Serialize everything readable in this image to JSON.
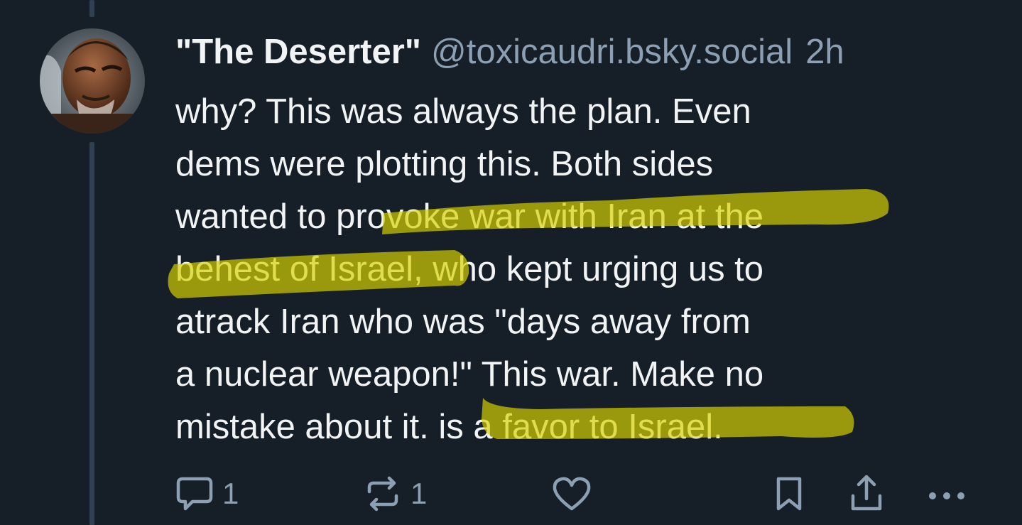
{
  "post": {
    "display_name": "\"The Deserter\"",
    "handle": "@toxicaudri.bsky.social",
    "time": "2h",
    "lines": [
      "why? This was always the plan. Even",
      "dems were plotting this. Both sides",
      "wanted to provoke war with Iran at the",
      "behest of Israel, who kept urging us to",
      "atrack Iran who was \"days away from",
      "a nuclear weapon!\" This war. Make no",
      "mistake about it. is a favor to Israel."
    ],
    "highlight_color": "#d8d300"
  },
  "actions": {
    "reply_count": "1",
    "repost_count": "1"
  },
  "icons": {
    "reply": "speech-bubble-icon",
    "repost": "repost-arrows-icon",
    "like": "heart-icon",
    "bookmark": "bookmark-icon",
    "share": "share-icon",
    "more": "more-dots-icon"
  }
}
